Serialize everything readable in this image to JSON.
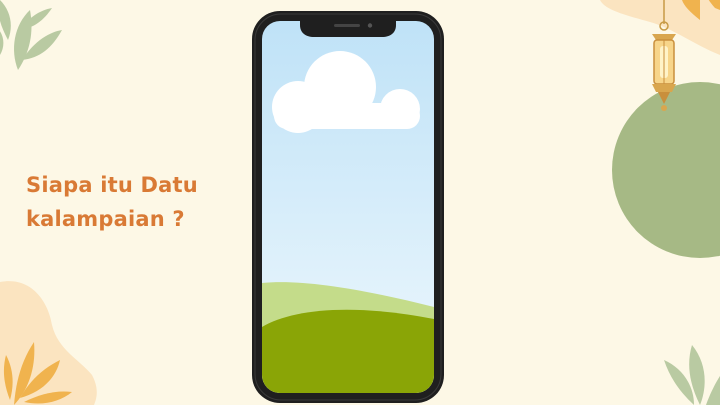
{
  "slide": {
    "question_line_1": "Siapa itu Datu",
    "question_line_2": "kalampaian ?"
  },
  "colors": {
    "background": "#fdf8e6",
    "accent_text": "#d97a35",
    "phone_body": "#1f1f1f",
    "sky_top": "#bfe2f7",
    "sky_bottom": "#eef8fd",
    "hill_light": "#c4dc8a",
    "hill_dark": "#8aa506",
    "circle_green": "#a6b985",
    "leaf_green": "#b9caa2",
    "leaf_orange": "#f0b34e",
    "blob_peach": "#fbe4c0"
  },
  "icons": {
    "top_left_decoration": "leaf-icon",
    "top_right_decoration": "lantern-icon",
    "bottom_left_decoration": "palm-leaf-icon",
    "bottom_right_decoration": "leaf-icon",
    "phone": "smartphone-icon"
  }
}
